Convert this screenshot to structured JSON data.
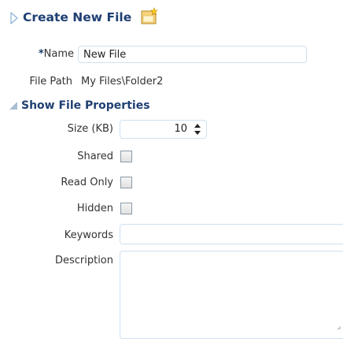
{
  "header": {
    "title": "Create New File",
    "file_icon": "new-file-icon",
    "chevron_icon": "chevron-right-icon"
  },
  "form": {
    "name": {
      "required_marker": "*",
      "label": "Name",
      "value": "New File"
    },
    "file_path": {
      "label": "File Path",
      "value": "My Files\\Folder2"
    },
    "properties_section": {
      "toggle_icon": "triangle-expanded-icon",
      "title": "Show File Properties",
      "size": {
        "label": "Size (KB)",
        "value": "10"
      },
      "shared": {
        "label": "Shared",
        "checked": false
      },
      "read_only": {
        "label": "Read Only",
        "checked": false
      },
      "hidden": {
        "label": "Hidden",
        "checked": false
      },
      "keywords": {
        "label": "Keywords",
        "value": ""
      },
      "description": {
        "label": "Description",
        "value": ""
      }
    }
  },
  "colors": {
    "title": "#1f3f72",
    "input_border": "#cfe0f0",
    "text": "#333333"
  }
}
